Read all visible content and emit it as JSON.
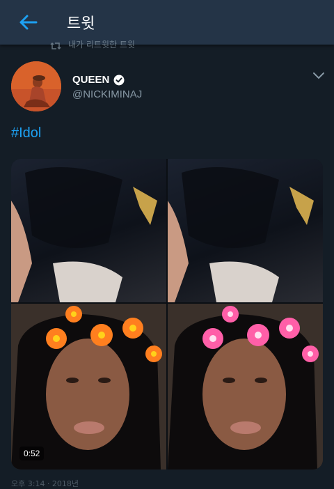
{
  "header": {
    "title": "트윗",
    "back_icon": "arrow-left-icon"
  },
  "retweet_note": {
    "text": "내가 리트윗한 트윗",
    "icon": "retweet-icon"
  },
  "tweet": {
    "author_name": "QUEEN",
    "verified_icon": "verified-badge-icon",
    "handle": "@NICKIMINAJ",
    "more_icon": "chevron-down-icon",
    "text": "#Idol",
    "media": {
      "type": "video",
      "duration": "0:52"
    },
    "timestamp_partial": "오후 3:14 · 2018년"
  },
  "colors": {
    "accent": "#1da1f2",
    "header_bg": "#243447",
    "page_bg": "#141d26",
    "secondary_text": "#8899a6"
  }
}
